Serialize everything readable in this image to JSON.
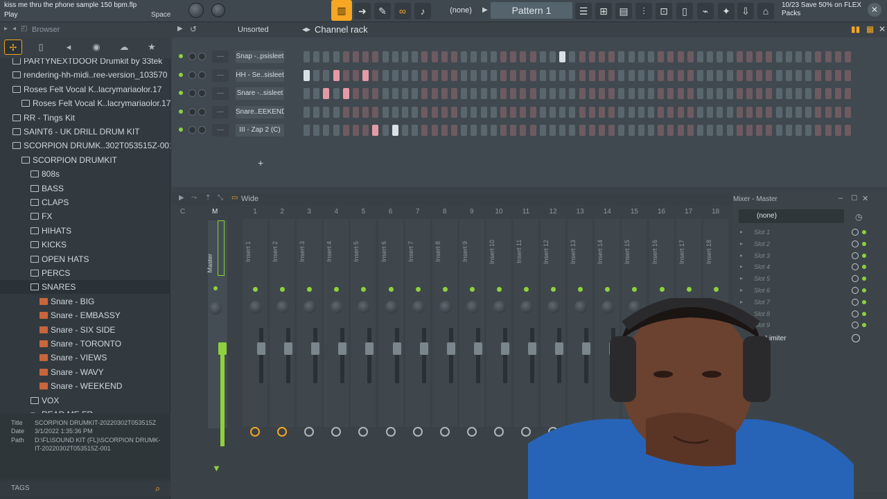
{
  "toolbar": {
    "project_title": "kiss me thru the phone sample 150 bpm.flp",
    "hint": "Play",
    "space": "Space",
    "pattern_selector": "(none)",
    "pattern": "Pattern 1",
    "promo_line1": "10/23  Save 50% on FLEX",
    "promo_line2": "Packs"
  },
  "browser": {
    "title": "Browser",
    "items": [
      {
        "label": "PARTYNEXTDOOR Drumkit by 33tek",
        "type": "folder",
        "indent": 1
      },
      {
        "label": "rendering-hh-midi..ree-version_103570",
        "type": "folder",
        "indent": 1
      },
      {
        "label": "Roses Felt Vocal K..lacrymariaolor.17",
        "type": "folder",
        "indent": 1
      },
      {
        "label": "Roses Felt Vocal K..lacrymariaolor.17",
        "type": "folder",
        "indent": 2
      },
      {
        "label": "RR - Tings Kit",
        "type": "folder",
        "indent": 1
      },
      {
        "label": "SAINT6 - UK DRILL DRUM KIT",
        "type": "folder",
        "indent": 1
      },
      {
        "label": "SCORPION DRUMK..302T053515Z-001",
        "type": "folder",
        "indent": 1
      },
      {
        "label": "SCORPION DRUMKIT",
        "type": "folder",
        "indent": 2
      },
      {
        "label": "808s",
        "type": "folder",
        "indent": 3
      },
      {
        "label": "BASS",
        "type": "folder",
        "indent": 3
      },
      {
        "label": "CLAPS",
        "type": "folder",
        "indent": 3
      },
      {
        "label": "FX",
        "type": "folder",
        "indent": 3
      },
      {
        "label": "HIHATS",
        "type": "folder",
        "indent": 3
      },
      {
        "label": "KICKS",
        "type": "folder",
        "indent": 3
      },
      {
        "label": "OPEN HATS",
        "type": "folder",
        "indent": 3
      },
      {
        "label": "PERCS",
        "type": "folder",
        "indent": 3
      },
      {
        "label": "SNARES",
        "type": "folder",
        "indent": 3
      },
      {
        "label": "Snare - BIG",
        "type": "file",
        "indent": 4
      },
      {
        "label": "Snare - EMBASSY",
        "type": "file",
        "indent": 4
      },
      {
        "label": "Snare - SIX SIDE",
        "type": "file",
        "indent": 4
      },
      {
        "label": "Snare - TORONTO",
        "type": "file",
        "indent": 4
      },
      {
        "label": "Snare - VIEWS",
        "type": "file",
        "indent": 4
      },
      {
        "label": "Snare - WAVY",
        "type": "file",
        "indent": 4
      },
      {
        "label": "Snare - WEEKEND",
        "type": "file",
        "indent": 4
      },
      {
        "label": "VOX",
        "type": "folder",
        "indent": 3
      },
      {
        "label": "READ ME FR",
        "type": "text",
        "indent": 3
      }
    ],
    "info": {
      "title_key": "Title",
      "title_val": "SCORPION DRUMKIT-20220302T053515Z",
      "date_key": "Date",
      "date_val": "3/1/2022 1:35:36 PM",
      "path_key": "Path",
      "path_val": "D:\\FL\\SOUND KIT (FL)\\SCORPION DRUMK-",
      "path_val2": "IT-20220302T053515Z-001"
    },
    "tags": "TAGS"
  },
  "channel_rack": {
    "sort": "Unsorted",
    "title": "Channel rack",
    "channels": [
      {
        "name": "Snap -..psisleet",
        "steps": [
          26
        ]
      },
      {
        "name": "HH - Se..sisleet",
        "steps": [
          0,
          3,
          6
        ]
      },
      {
        "name": "Snare -..sisleet",
        "steps": [
          2,
          4
        ]
      },
      {
        "name": "Snare..EEKEND",
        "steps": []
      },
      {
        "name": "III - Zap 2 (C)",
        "steps": [
          7,
          9
        ]
      }
    ],
    "add": "+"
  },
  "mixer": {
    "mode": "Wide",
    "master": "Master",
    "master_label": "M",
    "inserts": [
      "Insert 1",
      "Insert 2",
      "Insert 3",
      "Insert 4",
      "Insert 5",
      "Insert 6",
      "Insert 7",
      "Insert 8",
      "Insert 9",
      "Insert 10",
      "Insert 11",
      "Insert 12",
      "Insert 13",
      "Insert 14",
      "Insert 15",
      "Insert 16",
      "Insert 17",
      "Insert 18"
    ],
    "numbers": [
      "1",
      "2",
      "3",
      "4",
      "5",
      "6",
      "7",
      "8",
      "9",
      "10",
      "11",
      "12",
      "13",
      "14",
      "15",
      "16",
      "17",
      "18"
    ]
  },
  "mixer_panel": {
    "title": "Mixer - Master",
    "preset": "(none)",
    "slots": [
      "Slot 1",
      "Slot 2",
      "Slot 3",
      "Slot 4",
      "Slot 5",
      "Slot 6",
      "Slot 7",
      "Slot 8",
      "Slot 9"
    ],
    "limiter": "ty Limiter"
  },
  "colors": {
    "accent": "#f5a623",
    "led": "#8ed13c",
    "step_on": "#e49aa6",
    "step_active": "#d7e1e6"
  }
}
